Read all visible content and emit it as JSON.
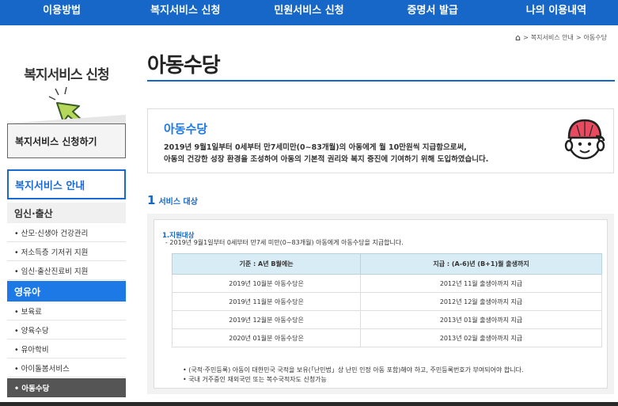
{
  "colors": {
    "nav_bg": "#1767c9",
    "accent_blue": "#1d79e6",
    "active_item_bg": "#555555",
    "table_header_bg": "#d8ecf5"
  },
  "topnav": {
    "items": [
      {
        "label": "이용방법"
      },
      {
        "label": "복지서비스 신청"
      },
      {
        "label": "민원서비스 신청"
      },
      {
        "label": "증명서 발급"
      },
      {
        "label": "나의 이용내역"
      }
    ]
  },
  "breadcrumb": {
    "icon": "home-icon",
    "separator": ">",
    "items": [
      "복지서비스 안내",
      "아동수당"
    ]
  },
  "sidebar": {
    "title": "복지서비스 신청",
    "apply_button": "복지서비스 신청하기",
    "guide_box": "복지서비스 안내",
    "section1": {
      "label": "임신·출산",
      "items": [
        "• 산모·신생아 건강관리",
        "• 저소득층 기저귀 지원",
        "• 임신·출산진료비 지원"
      ]
    },
    "section2": {
      "label": "영유아",
      "items": [
        "• 보육료",
        "• 양육수당",
        "• 유아학비",
        "• 아이돌봄서비스",
        "• 아동수당"
      ]
    }
  },
  "main": {
    "title": "아동수당",
    "intro": {
      "title": "아동수당",
      "line1": "2019년 9월1일부터 0세부터 만7세미만(0~83개월)의 아동에게 월 10만원씩 지급함으로써,",
      "line2": "아동의 건강한 성장 환경을 조성하여 아동의 기본적 권리와 복지 증진에 기여하기 위해 도입하였습니다."
    },
    "section": {
      "number": "1",
      "label": "서비스 대상"
    },
    "target": {
      "title": "1.지원대상",
      "desc": "- 2019년 9월1일부터 0세부터 만7세 미만(0~83개월) 아동에게 아동수당을 지급합니다."
    },
    "table": {
      "headers": [
        "기준 : A년 B월에는",
        "지급 : (A-6)년 (B+1)월 출생까지"
      ],
      "rows": [
        [
          "2019년 10월분 아동수당은",
          "2012년 11월 출생아까지 지급"
        ],
        [
          "2019년 11월분 아동수당은",
          "2012년 12월 출생아까지 지급"
        ],
        [
          "2019년 12월분 아동수당은",
          "2013년 01월 출생아까지 지급"
        ],
        [
          "2020년 01월분 아동수당은",
          "2013년 02월 출생아까지 지급"
        ]
      ]
    },
    "notes": [
      "• (국적·주민등록) 아동이 대한민국 국적을 보유(「난민법」상 난민 인정 아동 포함)해야 하고, 주민등록번호가 부여되어야 합니다.",
      "• 국내 거주중인 재외국민 또는 복수국적자도 신청가능"
    ]
  }
}
